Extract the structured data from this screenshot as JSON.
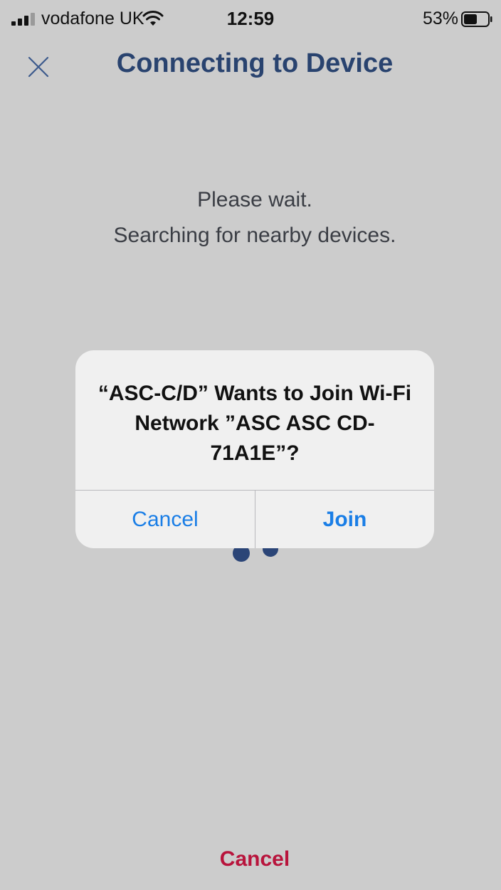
{
  "status_bar": {
    "carrier": "vodafone UK",
    "time": "12:59",
    "battery_percent": "53%"
  },
  "header": {
    "title": "Connecting to Device",
    "close_icon": "close-icon"
  },
  "message": {
    "line1": "Please wait.",
    "line2": "Searching for nearby devices."
  },
  "alert": {
    "title": "“ASC-C/D” Wants to Join Wi-Fi Network ”ASC ASC CD-71A1E”?",
    "cancel_label": "Cancel",
    "join_label": "Join"
  },
  "footer": {
    "cancel_label": "Cancel"
  },
  "colors": {
    "accent_title": "#29436f",
    "ios_blue": "#1a7ee6",
    "cancel_red": "#b8143c",
    "background": "#cccccc"
  }
}
